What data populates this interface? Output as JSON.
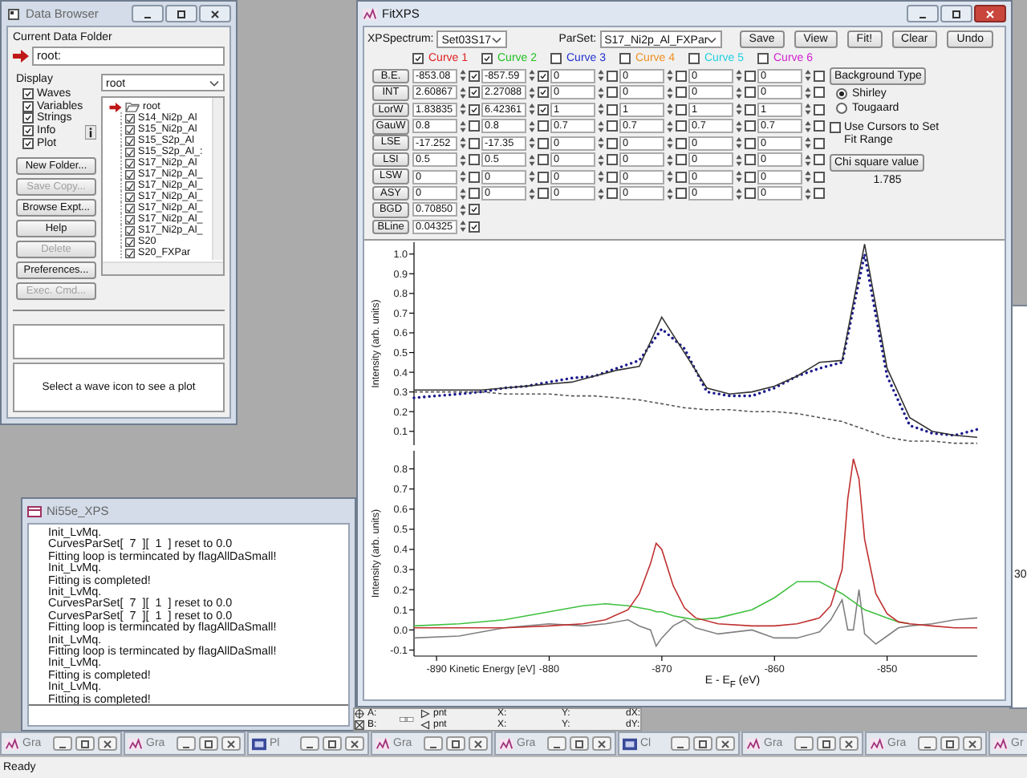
{
  "data_browser": {
    "title": "Data Browser",
    "current_folder_label": "Current Data Folder",
    "current_folder": "root:",
    "display_label": "Display",
    "display_options": [
      {
        "label": "Waves",
        "checked": true
      },
      {
        "label": "Variables",
        "checked": true
      },
      {
        "label": "Strings",
        "checked": true
      },
      {
        "label": "Info",
        "checked": true
      },
      {
        "label": "Plot",
        "checked": true
      }
    ],
    "buttons": [
      {
        "label": "New Folder...",
        "disabled": false
      },
      {
        "label": "Save Copy...",
        "disabled": true
      },
      {
        "label": "Browse Expt...",
        "disabled": false
      },
      {
        "label": "Help",
        "disabled": false
      },
      {
        "label": "Delete",
        "disabled": true
      },
      {
        "label": "Preferences...",
        "disabled": false
      },
      {
        "label": "Exec. Cmd...",
        "disabled": true
      }
    ],
    "folder_select": "root",
    "tree": {
      "label": "root",
      "expanded": true,
      "children": [
        {
          "label": "S14_Ni2p_Al"
        },
        {
          "label": "S15_Ni2p_Al"
        },
        {
          "label": "S15_S2p_Al"
        },
        {
          "label": "S15_S2p_Al_:"
        },
        {
          "label": "S17_Ni2p_Al"
        },
        {
          "label": "S17_Ni2p_Al_"
        },
        {
          "label": "S17_Ni2p_Al_"
        },
        {
          "label": "S17_Ni2p_Al_"
        },
        {
          "label": "S17_Ni2p_Al_"
        },
        {
          "label": "S17_Ni2p_Al_"
        },
        {
          "label": "S17_Ni2p_Al_"
        },
        {
          "label": "S20"
        },
        {
          "label": "S20_FXPar"
        }
      ]
    },
    "plot_hint": "Select a wave icon to see a plot"
  },
  "fit_window": {
    "title": "FitXPS",
    "spectrum_label": "XPSpectrum:",
    "spectrum": "Set03S17",
    "parset_label": "ParSet:",
    "parset": "S17_Ni2p_Al_FXPar",
    "buttons": [
      "Save",
      "View",
      "Fit!",
      "Clear",
      "Undo"
    ],
    "curves": [
      {
        "label": "Curve 1",
        "checked": true,
        "color": "#e02020"
      },
      {
        "label": "Curve 2",
        "checked": true,
        "color": "#20c020"
      },
      {
        "label": "Curve 3",
        "checked": false,
        "color": "#2030d0"
      },
      {
        "label": "Curve 4",
        "checked": false,
        "color": "#f09020"
      },
      {
        "label": "Curve 5",
        "checked": false,
        "color": "#20d0e0"
      },
      {
        "label": "Curve 6",
        "checked": false,
        "color": "#d020d0"
      }
    ],
    "parameters": [
      {
        "name": "B.E.",
        "cells": [
          {
            "value": "-853.08",
            "checked": true
          },
          {
            "value": "-857.59",
            "checked": true
          },
          {
            "value": "0",
            "checked": false
          },
          {
            "value": "0",
            "checked": false
          },
          {
            "value": "0",
            "checked": false
          },
          {
            "value": "0",
            "checked": false
          }
        ]
      },
      {
        "name": "INT",
        "cells": [
          {
            "value": "2.60867",
            "checked": true
          },
          {
            "value": "2.27088",
            "checked": true
          },
          {
            "value": "0",
            "checked": false
          },
          {
            "value": "0",
            "checked": false
          },
          {
            "value": "0",
            "checked": false
          },
          {
            "value": "0",
            "checked": false
          }
        ]
      },
      {
        "name": "LorW",
        "cells": [
          {
            "value": "1.83835",
            "checked": true
          },
          {
            "value": "6.42361",
            "checked": true
          },
          {
            "value": "1",
            "checked": false
          },
          {
            "value": "1",
            "checked": false
          },
          {
            "value": "1",
            "checked": false
          },
          {
            "value": "1",
            "checked": false
          }
        ]
      },
      {
        "name": "GauW",
        "cells": [
          {
            "value": "0.8",
            "checked": false
          },
          {
            "value": "0.8",
            "checked": false
          },
          {
            "value": "0.7",
            "checked": false
          },
          {
            "value": "0.7",
            "checked": false
          },
          {
            "value": "0.7",
            "checked": false
          },
          {
            "value": "0.7",
            "checked": false
          }
        ]
      },
      {
        "name": "LSE",
        "cells": [
          {
            "value": "-17.252",
            "checked": false
          },
          {
            "value": "-17.35",
            "checked": false
          },
          {
            "value": "0",
            "checked": false
          },
          {
            "value": "0",
            "checked": false
          },
          {
            "value": "0",
            "checked": false
          },
          {
            "value": "0",
            "checked": false
          }
        ]
      },
      {
        "name": "LSI",
        "cells": [
          {
            "value": "0.5",
            "checked": false
          },
          {
            "value": "0.5",
            "checked": false
          },
          {
            "value": "0",
            "checked": false
          },
          {
            "value": "0",
            "checked": false
          },
          {
            "value": "0",
            "checked": false
          },
          {
            "value": "0",
            "checked": false
          }
        ]
      },
      {
        "name": "LSW",
        "cells": [
          {
            "value": "0",
            "checked": false
          },
          {
            "value": "0",
            "checked": false
          },
          {
            "value": "0",
            "checked": false
          },
          {
            "value": "0",
            "checked": false
          },
          {
            "value": "0",
            "checked": false
          },
          {
            "value": "0",
            "checked": false
          }
        ]
      },
      {
        "name": "ASY",
        "cells": [
          {
            "value": "0",
            "checked": false
          },
          {
            "value": "0",
            "checked": false
          },
          {
            "value": "0",
            "checked": false
          },
          {
            "value": "0",
            "checked": false
          },
          {
            "value": "0",
            "checked": false
          },
          {
            "value": "0",
            "checked": false
          }
        ]
      },
      {
        "name": "BGD",
        "cells": [
          {
            "value": "0.70850",
            "checked": true
          }
        ]
      },
      {
        "name": "BLine",
        "cells": [
          {
            "value": "0.04325",
            "checked": true
          }
        ]
      }
    ],
    "background_type_button": "Background Type",
    "background_types": [
      {
        "label": "Shirley",
        "selected": true
      },
      {
        "label": "Tougaard",
        "selected": false
      }
    ],
    "use_cursors": {
      "label": "Use Cursors to Set Fit Range",
      "checked": false
    },
    "chi_button": "Chi square value",
    "chi_value": "1.785",
    "plots": [
      {
        "chart_data": {
          "type": "line",
          "ylabel": "Intensity (arb. units)",
          "ylim": [
            0.03,
            1.06
          ],
          "yticks": [
            0.1,
            0.2,
            0.3,
            0.4,
            0.5,
            0.6,
            0.7,
            0.8,
            0.9,
            {
              "value": 1,
              "label": "1.0"
            }
          ],
          "series": [
            {
              "line_style": "dotted",
              "color": "#1a1a8c",
              "values": [
                0.27,
                0.28,
                0.29,
                0.3,
                0.32,
                0.33,
                0.35,
                0.37,
                0.38,
                0.42,
                0.46,
                0.62,
                0.52,
                0.3,
                0.28,
                0.28,
                0.32,
                0.38,
                0.42,
                0.45,
                1.0,
                0.38,
                0.13,
                0.09,
                0.08,
                0.11
              ]
            },
            {
              "line_style": "solid",
              "color": "#333333",
              "values": [
                0.31,
                0.31,
                0.31,
                0.31,
                0.32,
                0.33,
                0.34,
                0.35,
                0.38,
                0.41,
                0.43,
                0.68,
                0.5,
                0.32,
                0.29,
                0.3,
                0.33,
                0.38,
                0.45,
                0.46,
                1.05,
                0.42,
                0.17,
                0.1,
                0.08,
                0.07
              ]
            },
            {
              "line_style": "dashed",
              "color": "#555555",
              "values": [
                0.3,
                0.3,
                0.3,
                0.3,
                0.29,
                0.29,
                0.29,
                0.28,
                0.28,
                0.27,
                0.26,
                0.24,
                0.22,
                0.21,
                0.21,
                0.2,
                0.2,
                0.19,
                0.17,
                0.15,
                0.11,
                0.07,
                0.05,
                0.05,
                0.04,
                0.04
              ]
            }
          ]
        }
      },
      {
        "chart_data": {
          "type": "line",
          "ylabel": "Intensity (arb. units)",
          "xlabel": "E - E$_{F}$ (eV)",
          "xlim": [
            -892,
            -842
          ],
          "ylim": [
            -0.13,
            0.89
          ],
          "x": [
            -892,
            -888,
            -884,
            -880,
            -877,
            -875,
            -873,
            -872,
            -871,
            -870.5,
            -870,
            -869,
            -868,
            -867,
            -865,
            -862,
            -860,
            -858,
            -856,
            -855,
            -854,
            -853.5,
            -853,
            -852.5,
            -852,
            -851,
            -850,
            -849,
            -848,
            -846,
            -844,
            -842
          ],
          "xticks": [
            -890,
            -880,
            -870,
            -860,
            -850
          ],
          "yticks": [
            {
              "value": -0.1,
              "label": "-0.1"
            },
            {
              "value": 0,
              "label": "0.0"
            },
            0.1,
            0.2,
            0.3,
            0.4,
            0.5,
            0.6,
            0.7,
            0.8
          ],
          "series": [
            {
              "line_style": "solid",
              "color": "#808080",
              "values": [
                -0.04,
                -0.03,
                0.01,
                0.03,
                0.02,
                0.03,
                0.05,
                0.02,
                0.0,
                -0.08,
                -0.04,
                0.02,
                0.05,
                0.01,
                -0.02,
                0.0,
                -0.04,
                -0.04,
                -0.01,
                0.05,
                0.15,
                0.0,
                0.0,
                0.2,
                -0.02,
                -0.07,
                -0.03,
                0.01,
                0.02,
                0.03,
                0.05,
                0.06
              ]
            },
            {
              "line_style": "solid",
              "color": "#40c040",
              "values": [
                0.02,
                0.03,
                0.05,
                0.09,
                0.12,
                0.13,
                0.12,
                0.11,
                0.1,
                0.09,
                0.09,
                0.07,
                0.06,
                0.05,
                0.06,
                0.1,
                0.16,
                0.24,
                0.24,
                0.21,
                0.18,
                0.16,
                0.14,
                0.12,
                0.1,
                0.08,
                0.06,
                0.04,
                0.03,
                null,
                null,
                null
              ]
            },
            {
              "line_style": "solid",
              "color": "#c03030",
              "values": [
                0.01,
                0.01,
                0.01,
                0.02,
                0.03,
                0.05,
                0.1,
                0.18,
                0.33,
                0.43,
                0.4,
                0.22,
                0.11,
                0.06,
                0.03,
                0.02,
                0.02,
                0.03,
                0.06,
                0.12,
                0.3,
                0.65,
                0.85,
                0.75,
                0.45,
                0.18,
                0.08,
                0.04,
                0.03,
                0.02,
                0.01,
                0.01
              ]
            }
          ]
        },
        "axis_note": "Kinetic Energy [eV]"
      }
    ]
  },
  "console": {
    "title": "Ni55e_XPS",
    "lines": [
      "Init_LvMq.",
      "CurvesParSet[  7  ][  1  ] reset to 0.0",
      "Fitting loop is termincated by flagAllDaSmall!",
      "Init_LvMq.",
      "Fitting is completed!",
      "Init_LvMq.",
      "CurvesParSet[  7  ][  1  ] reset to 0.0",
      "CurvesParSet[  7  ][  1  ] reset to 0.0",
      "Fitting loop is termincated by flagAllDaSmall!",
      "Init_LvMq.",
      "Fitting loop is termincated by flagAllDaSmall!",
      "Init_LvMq.",
      "Fitting is completed!",
      "Init_LvMq.",
      "Fitting is completed!"
    ]
  },
  "background_window": {
    "text": "30"
  },
  "cursor_bar": {
    "a": "A:",
    "b": "B:",
    "point_a": "pnt",
    "point_b": "pnt",
    "x_a": "X:",
    "x_b": "X:",
    "y_a": "Y:",
    "y_b": "Y:",
    "dx": "dX:",
    "dy": "dY:"
  },
  "taskbar": [
    {
      "label": "Gra",
      "kind": "graph"
    },
    {
      "label": "Gra",
      "kind": "graph"
    },
    {
      "label": "Pl",
      "kind": "panel"
    },
    {
      "label": "Gra",
      "kind": "graph"
    },
    {
      "label": "Gra",
      "kind": "graph"
    },
    {
      "label": "Cl",
      "kind": "panel"
    },
    {
      "label": "Gra",
      "kind": "graph"
    },
    {
      "label": "Gra",
      "kind": "graph"
    },
    {
      "label": "Gr",
      "kind": "graph"
    }
  ],
  "status_bar": "Ready"
}
